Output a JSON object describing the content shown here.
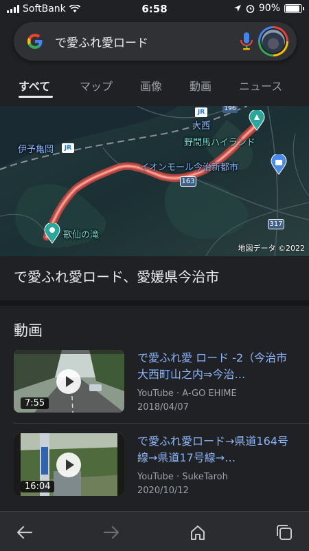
{
  "status_bar": {
    "carrier": "SoftBank",
    "time": "6:58",
    "battery": "90%",
    "battery_level": 0.9
  },
  "search": {
    "query": "で愛ふれ愛ロード"
  },
  "tabs": [
    {
      "label": "すべて",
      "active": true
    },
    {
      "label": "マップ",
      "active": false
    },
    {
      "label": "画像",
      "active": false
    },
    {
      "label": "動画",
      "active": false
    },
    {
      "label": "ニュース",
      "active": false
    }
  ],
  "map": {
    "labels": {
      "iyo_kameoka": "伊予亀岡",
      "onishi": "大西",
      "noma_highland": "野間馬ハイランド",
      "aeon_mall": "イオンモール今治新都市",
      "kasen_falls": "歌仙の滝"
    },
    "road_signs": {
      "r196": "196",
      "r163": "163",
      "r317": "317"
    },
    "jr_badge": "JR",
    "credit": "地図データ ©2022",
    "route_color": "#e8716a"
  },
  "place": {
    "title": "で愛ふれ愛ロード、愛媛県今治市"
  },
  "videos_section": {
    "title": "動画",
    "items": [
      {
        "title": "で愛ふれ愛 ロード -2（今治市大西町山之内⇒今治…",
        "source": "YouTube · A-GO EHIME",
        "date": "2018/04/07",
        "duration": "7:55"
      },
      {
        "title": "で愛ふれ愛ロード→県道164号線→県道17号線→…",
        "source": "YouTube · SukeTaroh",
        "date": "2020/10/12",
        "duration": "16:04"
      }
    ]
  },
  "bottom_nav": {
    "icons": [
      "back-arrow-icon",
      "forward-arrow-icon",
      "home-icon",
      "tabs-icon"
    ]
  }
}
